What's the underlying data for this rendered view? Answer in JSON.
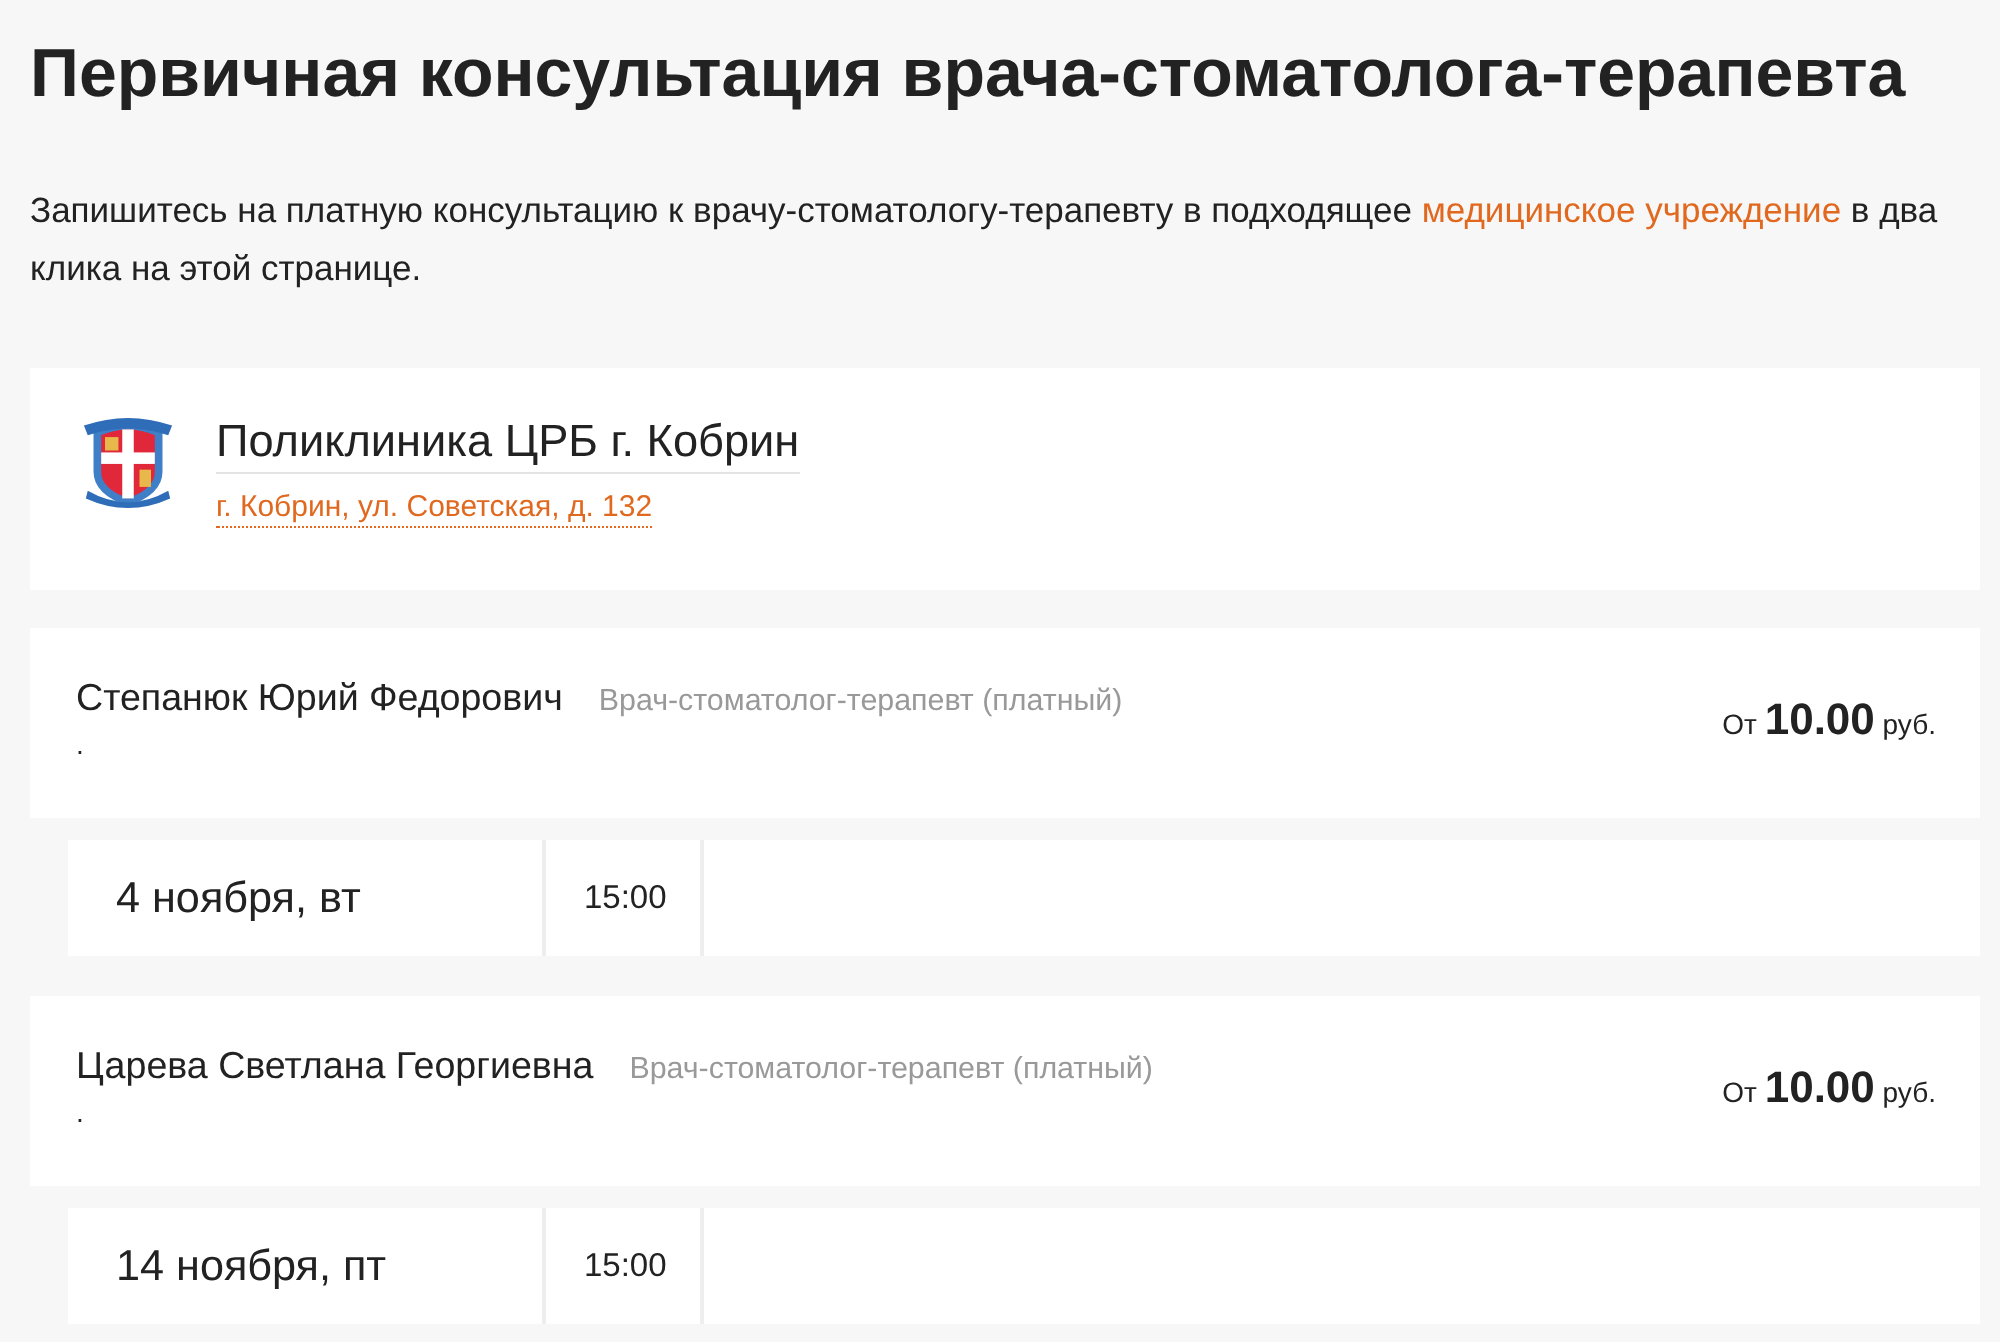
{
  "page": {
    "title": "Первичная консультация врача-стоматолога-терапевта",
    "intro": {
      "before": "Запишитесь на платную консультацию к врачу-стоматологу-терапевту в подходящее ",
      "link": "медицинское учреждение",
      "after": " в два клика на этой странице."
    }
  },
  "clinic": {
    "name": "Поликлиника ЦРБ г. Кобрин",
    "address": "г. Кобрин, ул. Советская, д. 132"
  },
  "doctors": [
    {
      "name": "Степанюк Юрий Федорович",
      "specialty": "Врач-стоматолог-терапевт (платный)",
      "note": ".",
      "price": "От **10.00** руб.",
      "slots": [
        {
          "date": "4 ноября, вт",
          "times": [
            "15:00"
          ]
        }
      ]
    },
    {
      "name": "Царева Светлана Георгиевна",
      "specialty": "Врач-стоматолог-терапевт (платный)",
      "note": ".",
      "price": "От **10.00** руб.",
      "slots": [
        {
          "date": "14 ноября, пт",
          "times": [
            "15:00"
          ]
        }
      ]
    }
  ]
}
